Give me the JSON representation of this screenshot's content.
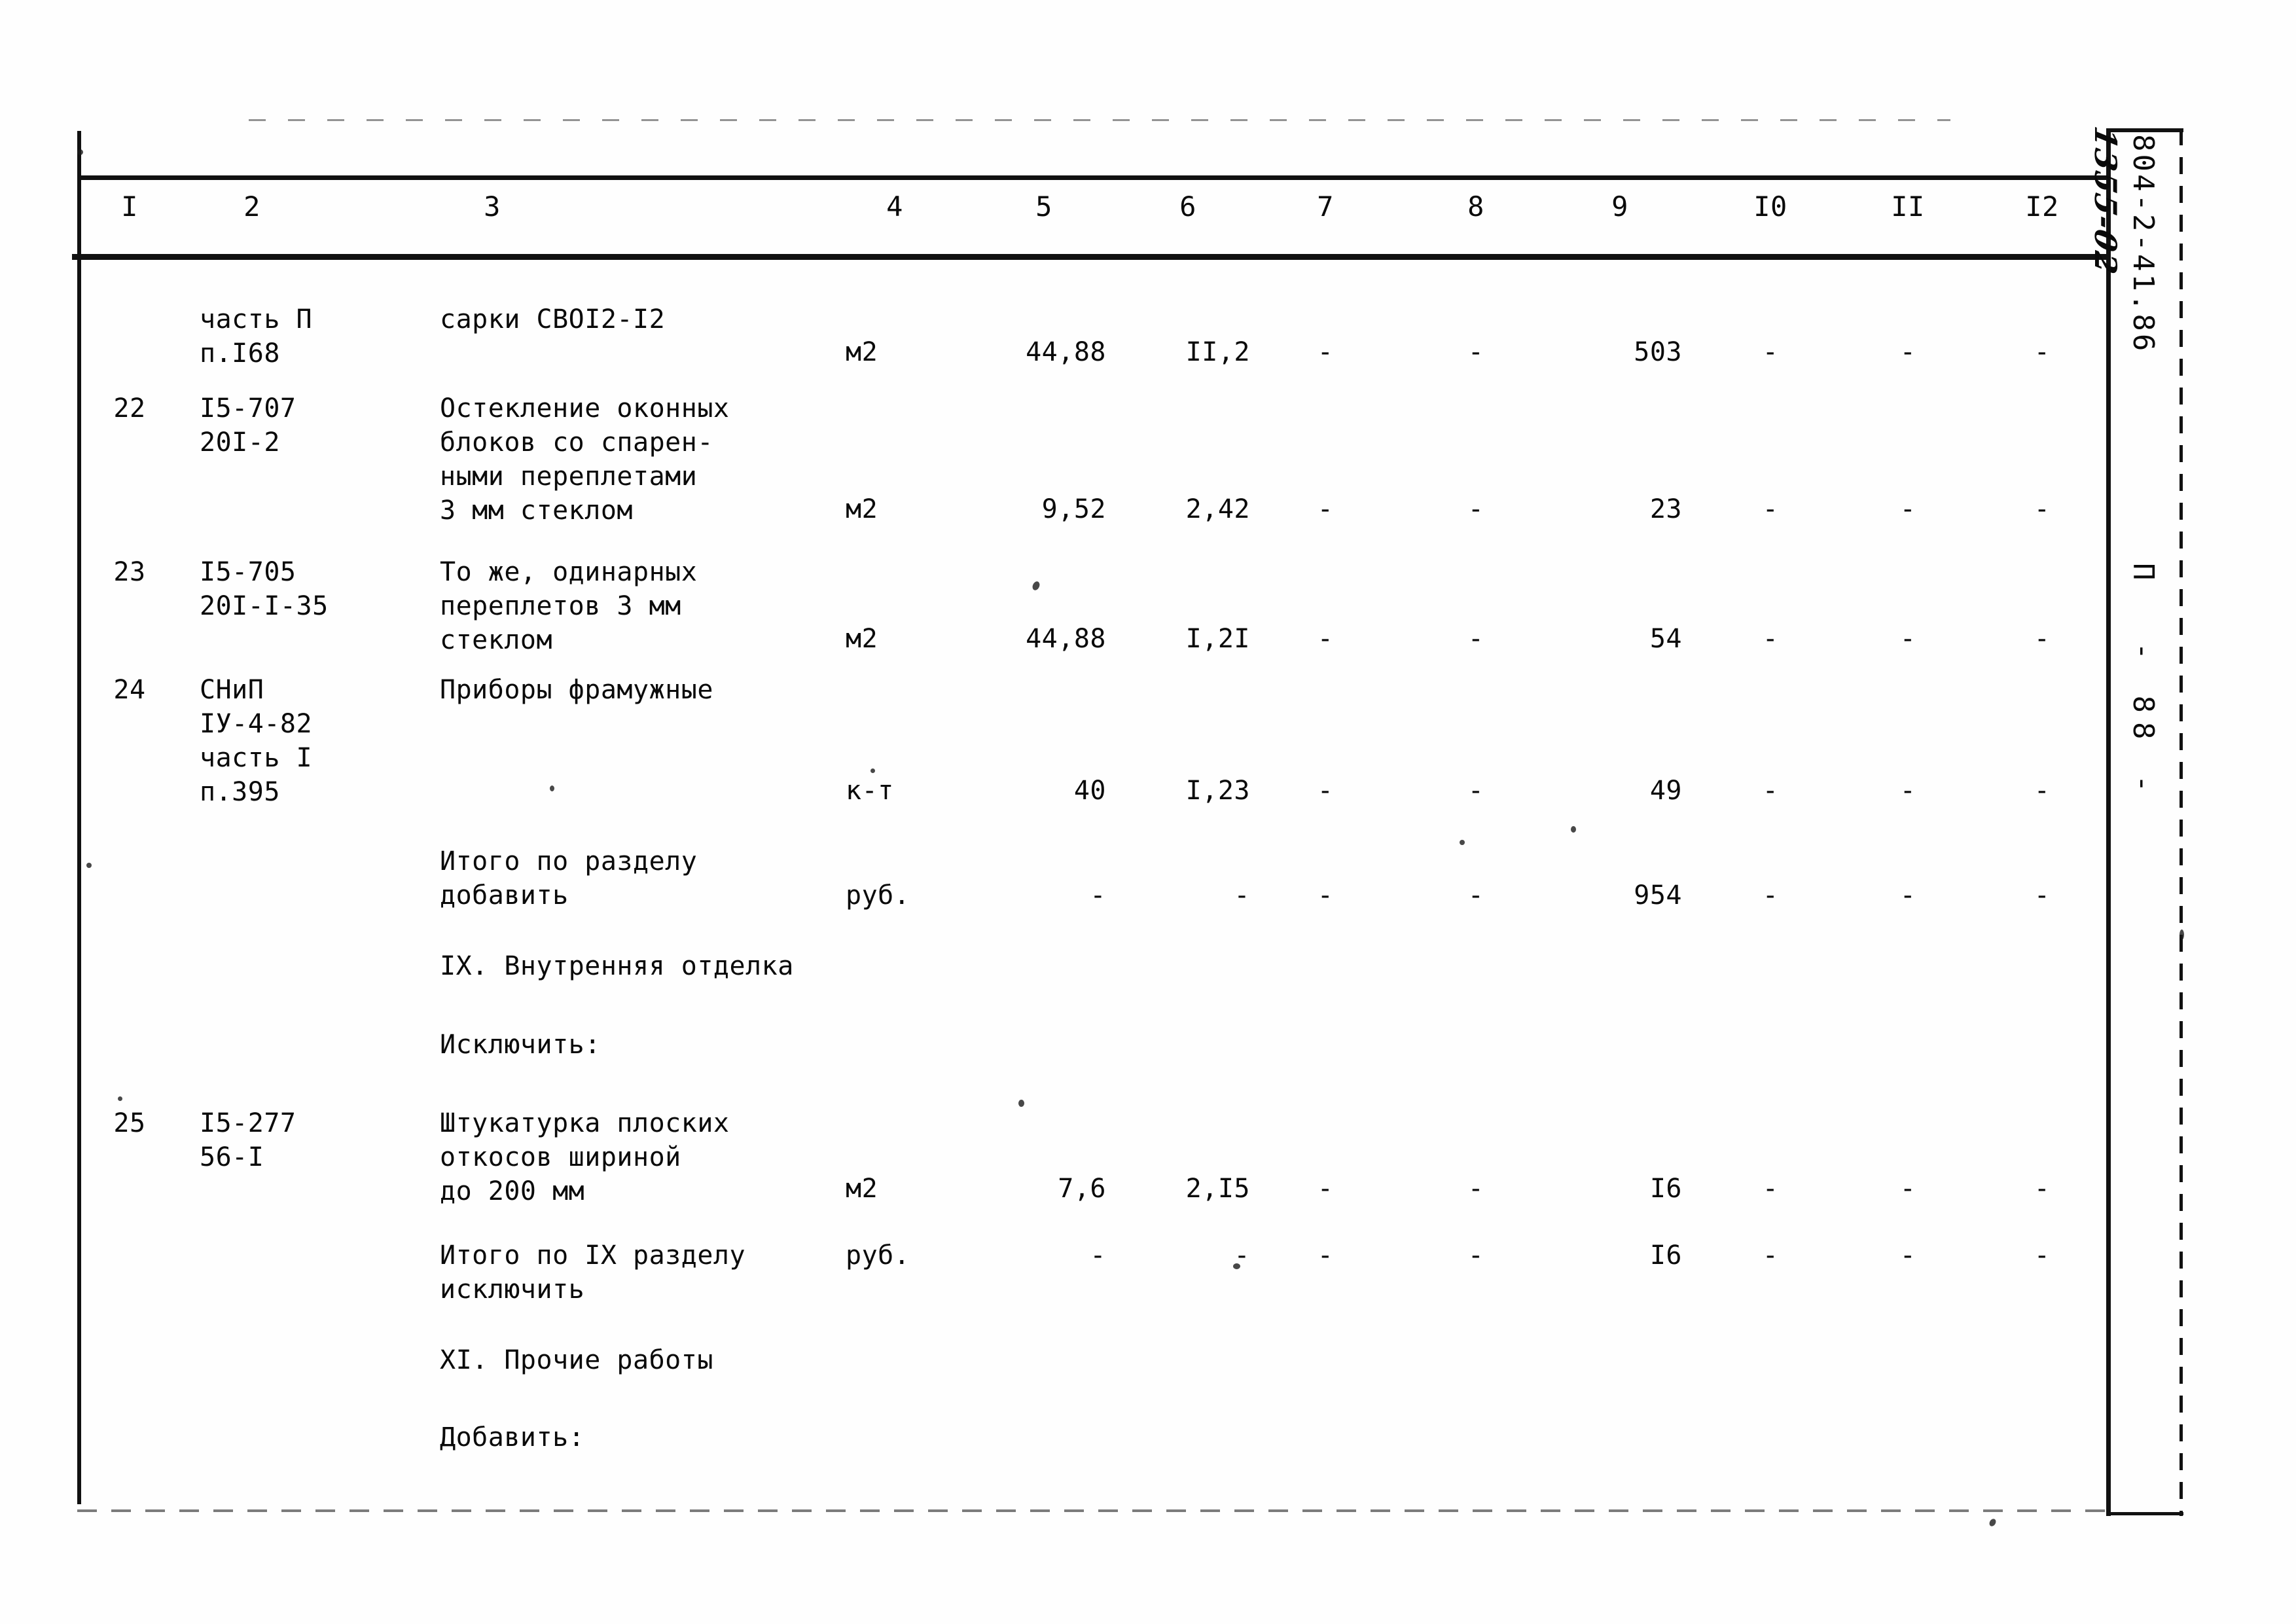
{
  "document": {
    "margin_code": "804-2-41.86",
    "margin_handwritten": "1355-02",
    "page_marker": "П  - 88 -"
  },
  "table": {
    "column_headers": [
      "I",
      "2",
      "3",
      "4",
      "5",
      "6",
      "7",
      "8",
      "9",
      "I0",
      "II",
      "I2"
    ],
    "dash": "-",
    "rows": [
      {
        "num": "",
        "code": [
          "часть П",
          "п.I68"
        ],
        "name": [
          "сарки СВОI2-I2"
        ],
        "unit": "м2",
        "c5": "44,88",
        "c6": "II,2",
        "c7": "-",
        "c8": "-",
        "c9": "503",
        "c10": "-",
        "c11": "-",
        "c12": "-"
      },
      {
        "num": "22",
        "code": [
          "I5-707",
          "20I-2"
        ],
        "name": [
          "Остекление оконных",
          "блоков со спарен-",
          "ными переплетами",
          "3 мм стеклом"
        ],
        "unit": "м2",
        "c5": "9,52",
        "c6": "2,42",
        "c7": "-",
        "c8": "-",
        "c9": "23",
        "c10": "-",
        "c11": "-",
        "c12": "-"
      },
      {
        "num": "23",
        "code": [
          "I5-705",
          "20I-I-35"
        ],
        "name": [
          "То же, одинарных",
          "переплетов 3 мм",
          "стеклом"
        ],
        "unit": "м2",
        "c5": "44,88",
        "c6": "I,2I",
        "c7": "-",
        "c8": "-",
        "c9": "54",
        "c10": "-",
        "c11": "-",
        "c12": "-"
      },
      {
        "num": "24",
        "code": [
          "СНиП",
          "IУ-4-82",
          "часть I",
          "п.395"
        ],
        "name": [
          "Приборы фрамужные"
        ],
        "unit": "к-т",
        "c5": "40",
        "c6": "I,23",
        "c7": "-",
        "c8": "-",
        "c9": "49",
        "c10": "-",
        "c11": "-",
        "c12": "-"
      },
      {
        "num": "",
        "code": [],
        "name": [
          "Итого по разделу",
          "добавить"
        ],
        "unit": "руб.",
        "c5": "-",
        "c6": "-",
        "c7": "-",
        "c8": "-",
        "c9": "954",
        "c10": "-",
        "c11": "-",
        "c12": "-"
      },
      {
        "num": "",
        "code": [],
        "name": [
          "IX. Внутренняя отделка"
        ],
        "unit": "",
        "c5": "",
        "c6": "",
        "c7": "",
        "c8": "",
        "c9": "",
        "c10": "",
        "c11": "",
        "c12": ""
      },
      {
        "num": "",
        "code": [],
        "name": [
          "Исключить:"
        ],
        "unit": "",
        "c5": "",
        "c6": "",
        "c7": "",
        "c8": "",
        "c9": "",
        "c10": "",
        "c11": "",
        "c12": ""
      },
      {
        "num": "25",
        "code": [
          "I5-277",
          "56-I"
        ],
        "name": [
          "Штукатурка плоских",
          "откосов шириной",
          "до 200 мм"
        ],
        "unit": "м2",
        "c5": "7,6",
        "c6": "2,I5",
        "c7": "-",
        "c8": "-",
        "c9": "I6",
        "c10": "-",
        "c11": "-",
        "c12": "-"
      },
      {
        "num": "",
        "code": [],
        "name": [
          "Итого по IX разделу",
          "исключить"
        ],
        "unit": "руб.",
        "c5": "-",
        "c6": "-",
        "c7": "-",
        "c8": "-",
        "c9": "I6",
        "c10": "-",
        "c11": "-",
        "c12": "-"
      },
      {
        "num": "",
        "code": [],
        "name": [
          "XI. Прочие работы"
        ],
        "unit": "",
        "c5": "",
        "c6": "",
        "c7": "",
        "c8": "",
        "c9": "",
        "c10": "",
        "c11": "",
        "c12": ""
      },
      {
        "num": "",
        "code": [],
        "name": [
          "Добавить:"
        ],
        "unit": "",
        "c5": "",
        "c6": "",
        "c7": "",
        "c8": "",
        "c9": "",
        "c10": "",
        "c11": "",
        "c12": ""
      }
    ]
  }
}
